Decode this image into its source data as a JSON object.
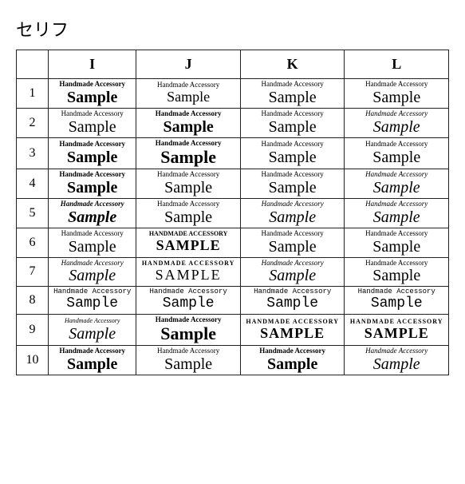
{
  "title": "セリフ",
  "headers": [
    "",
    "I",
    "J",
    "K",
    "L"
  ],
  "sub_text": "Handmade Accessory",
  "main_text": "Sample",
  "rows": [
    {
      "num": "1"
    },
    {
      "num": "2"
    },
    {
      "num": "3"
    },
    {
      "num": "4"
    },
    {
      "num": "5"
    },
    {
      "num": "6"
    },
    {
      "num": "7"
    },
    {
      "num": "8"
    },
    {
      "num": "9"
    },
    {
      "num": "10"
    }
  ]
}
